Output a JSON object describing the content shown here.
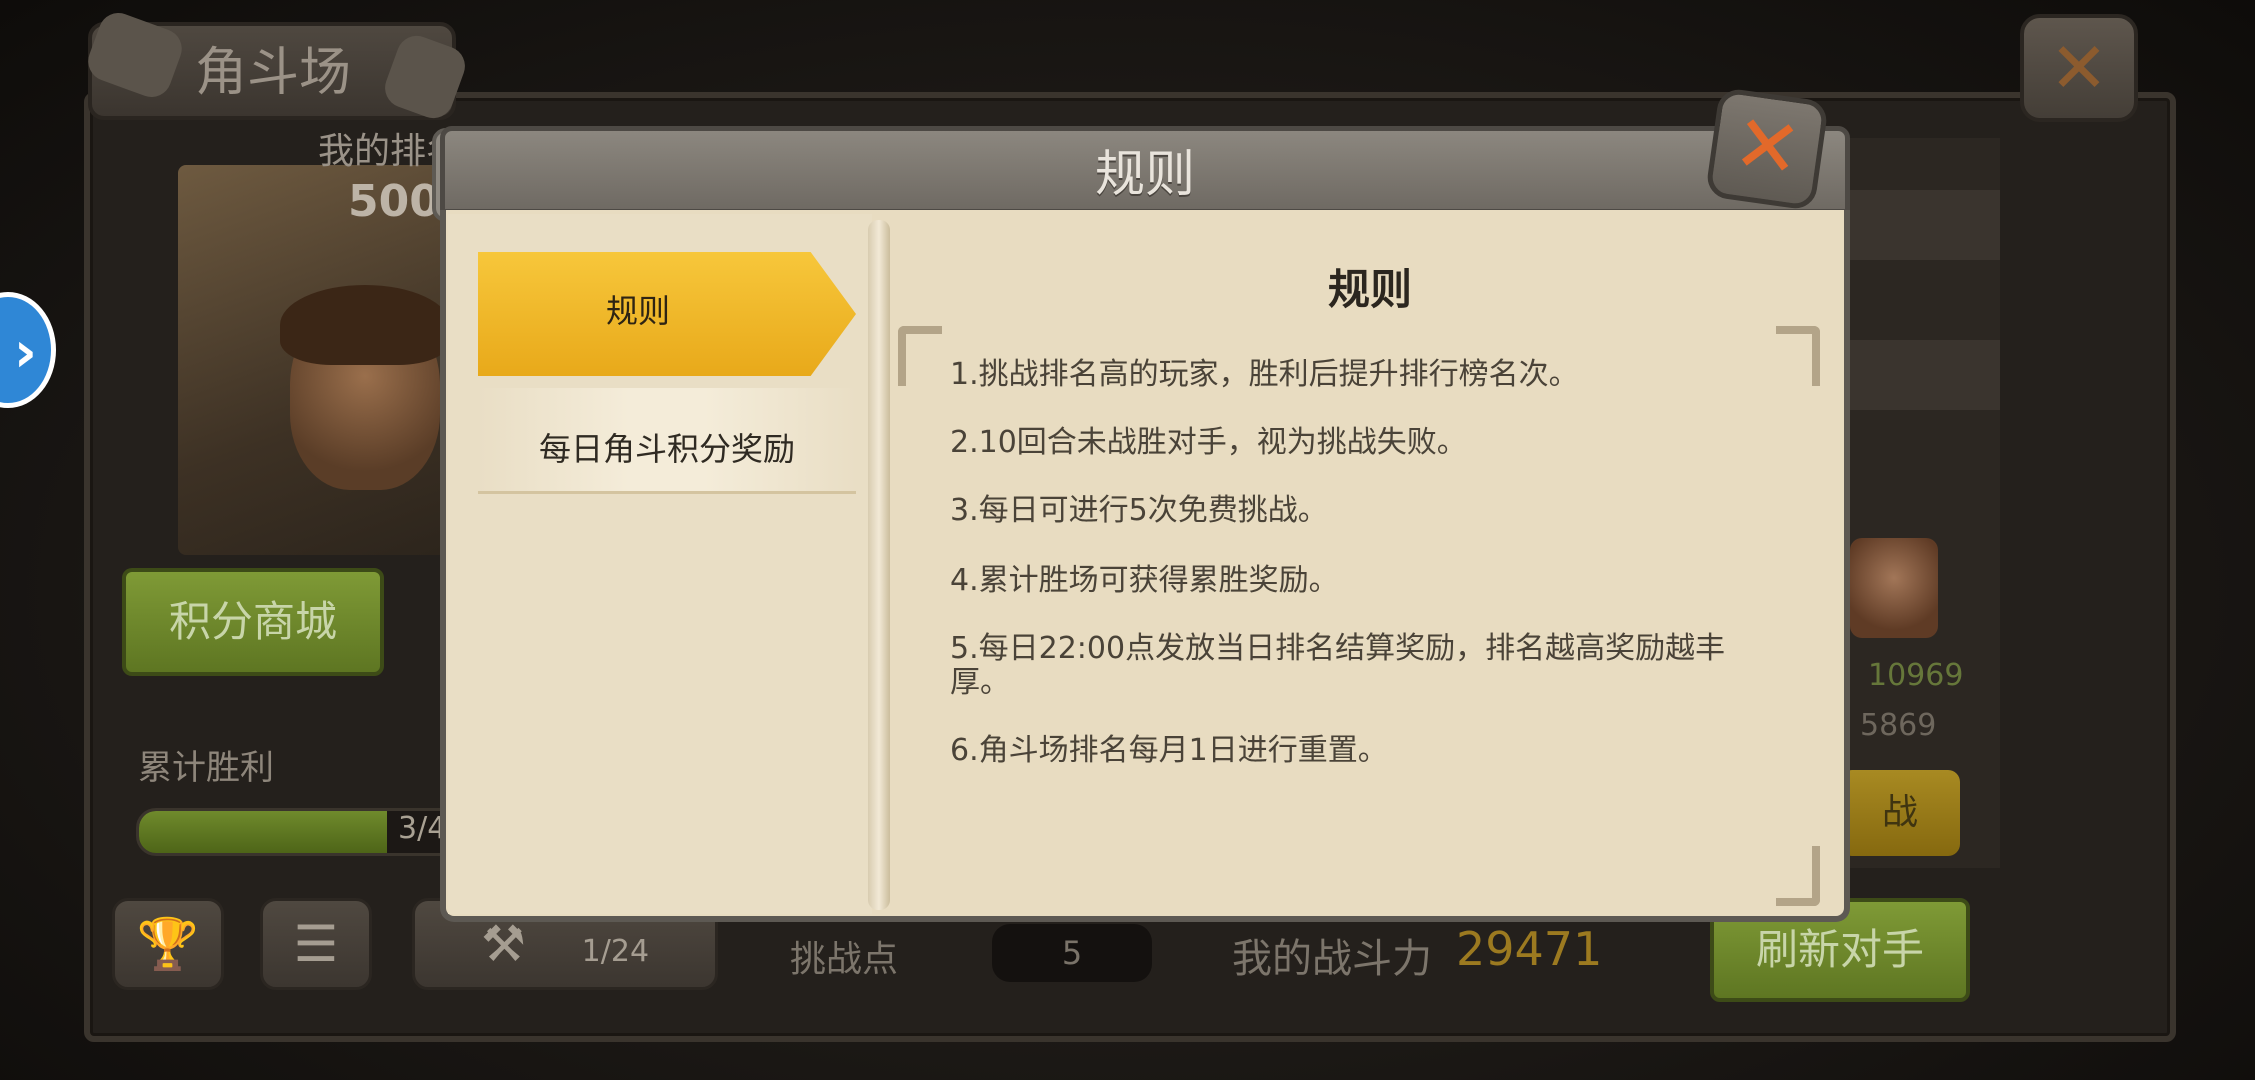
{
  "background": {
    "page_title": "角斗场",
    "my_rank_label": "我的排名",
    "my_rank_value": "500",
    "shop_button": "积分商城",
    "cumulative_wins_label": "累计胜利",
    "cumulative_wins_progress": {
      "current": 3,
      "total": 4,
      "text": "3/4"
    },
    "third_tab_partial": "1/24",
    "challenge_points_label": "挑战点",
    "challenge_points_value": "5",
    "my_power_label": "我的战斗力",
    "my_power_value": "29471",
    "refresh_button": "刷新对手",
    "opponent": {
      "score_1": "10969",
      "score_2": "5869",
      "fight_button": "战"
    }
  },
  "modal": {
    "header_title": "规则",
    "tabs": [
      {
        "label": "规则",
        "selected": true
      },
      {
        "label": "每日角斗积分奖励",
        "selected": false
      }
    ],
    "content_title": "规则",
    "rules": [
      "1.挑战排名高的玩家，胜利后提升排行榜名次。",
      "2.10回合未战胜对手，视为挑战失败。",
      "3.每日可进行5次免费挑战。",
      "4.累计胜场可获得累胜奖励。",
      "5.每日22:00点发放当日排名结算奖励，排名越高奖励越丰厚。",
      "6.角斗场排名每月1日进行重置。"
    ]
  },
  "icons": {
    "close": "close-icon",
    "trophy": "trophy-icon",
    "list": "list-icon",
    "axe": "axe-icon",
    "side_arrow": "chevron-right-icon"
  },
  "colors": {
    "tab_selected": "#f2bd2f",
    "modal_body": "#e8dcc1",
    "close_x": "#e2692a",
    "power_value": "#9c7a20",
    "green_button": "#6f8a2c"
  }
}
